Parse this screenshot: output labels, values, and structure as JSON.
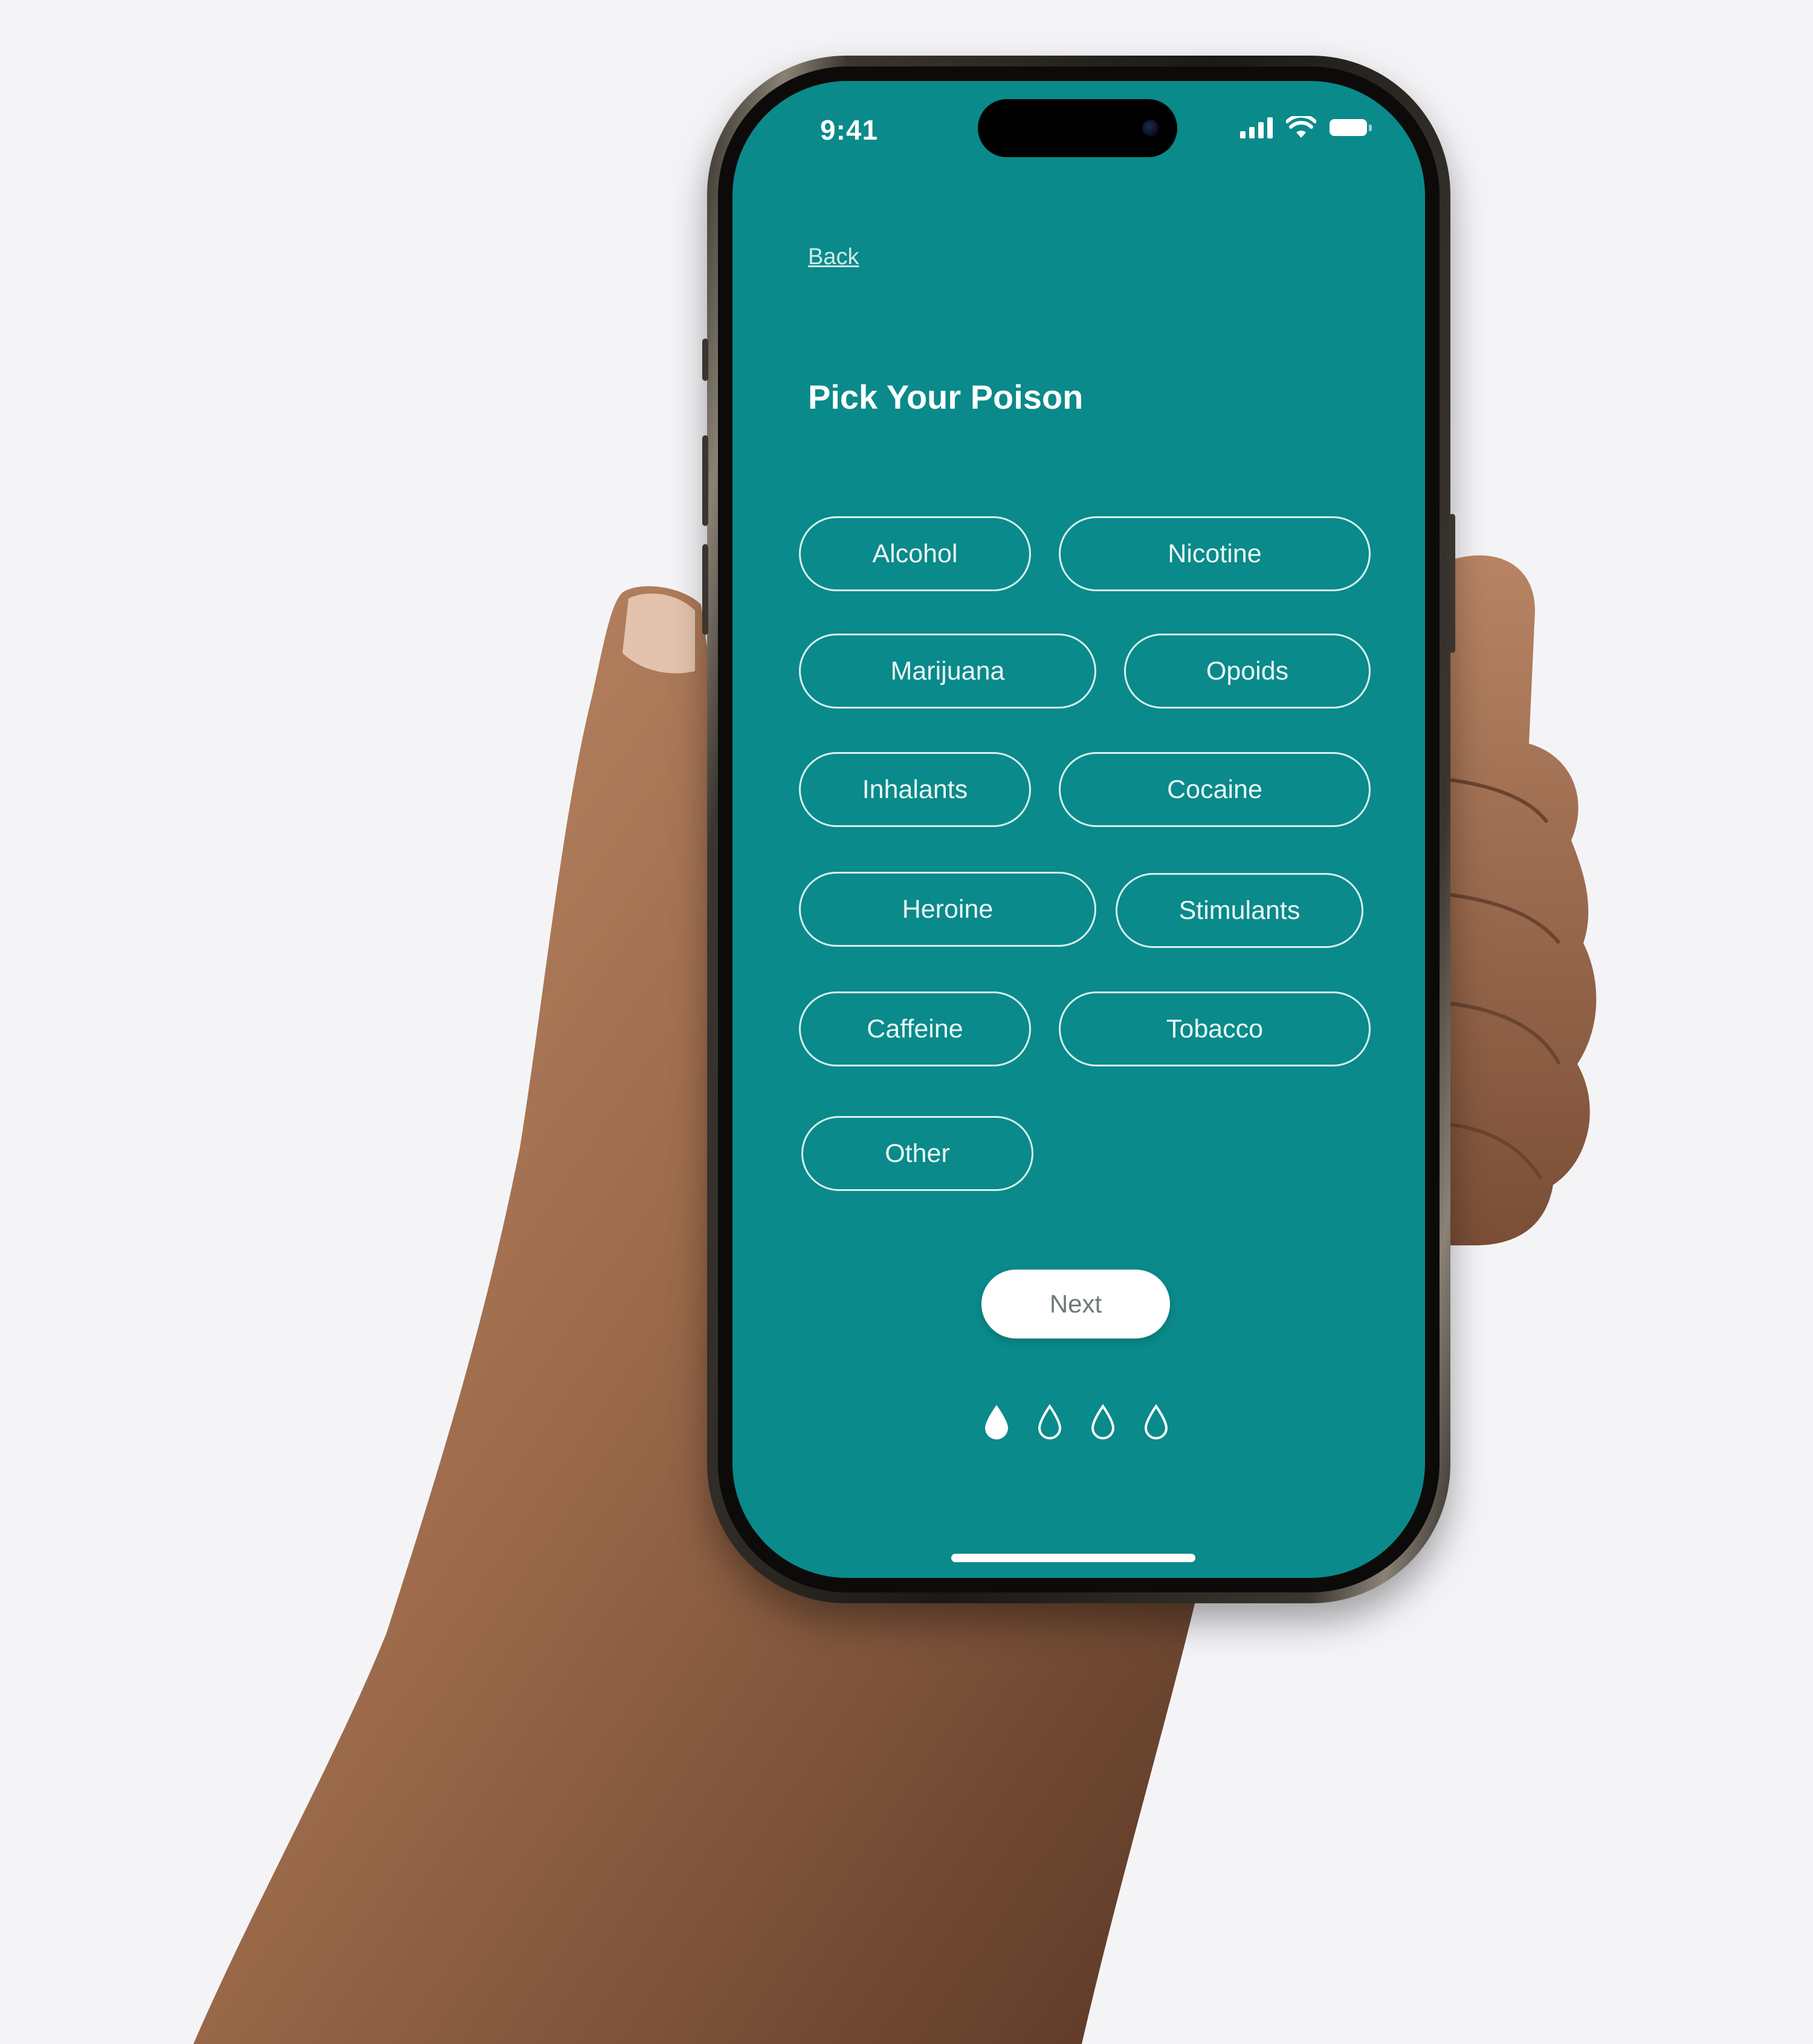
{
  "status_bar": {
    "time": "9:41"
  },
  "nav": {
    "back_label": "Back"
  },
  "page": {
    "title": "Pick Your Poison"
  },
  "options": [
    "Alcohol",
    "Nicotine",
    "Marijuana",
    "Opoids",
    "Inhalants",
    "Cocaine",
    "Heroine",
    "Stimulants",
    "Caffeine",
    "Tobacco",
    "Other"
  ],
  "actions": {
    "next_label": "Next"
  },
  "pagination": {
    "total_steps": 4,
    "current_step": 1
  },
  "colors": {
    "screen_bg": "#0a8a8a",
    "chip_border": "#d8f1f0",
    "button_bg": "#ffffff",
    "page_bg": "#f4f4f7"
  }
}
